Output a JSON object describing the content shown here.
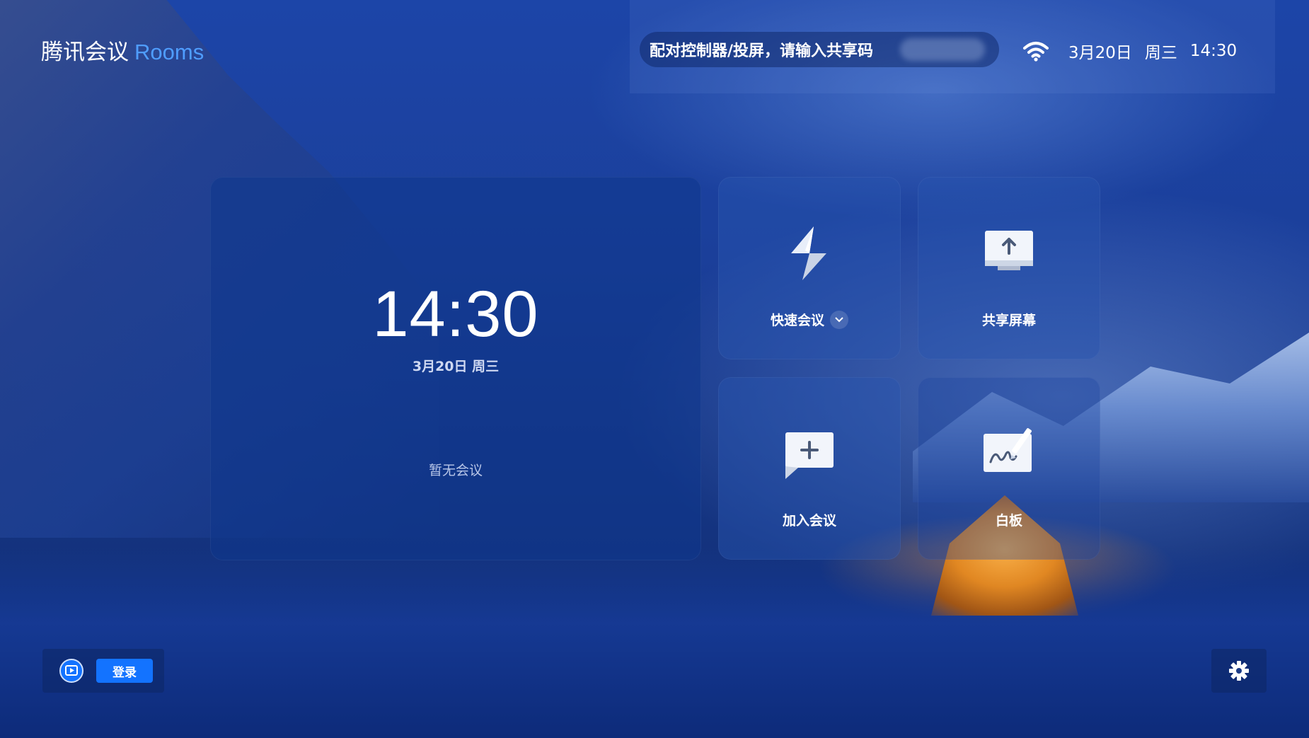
{
  "brand": {
    "name_cn": "腾讯会议",
    "name_en": "Rooms"
  },
  "header": {
    "pair_prompt": "配对控制器/投屏，请输入共享码",
    "date": "3月20日",
    "weekday": "周三",
    "time": "14:30",
    "wifi_icon": "wifi-icon"
  },
  "clock": {
    "time": "14:30",
    "date": "3月20日  周三",
    "empty_message": "暂无会议"
  },
  "tiles": [
    {
      "label": "快速会议",
      "icon": "lightning-icon",
      "has_dropdown": true
    },
    {
      "label": "共享屏幕",
      "icon": "share-screen-icon"
    },
    {
      "label": "加入会议",
      "icon": "join-meeting-icon"
    },
    {
      "label": "白板",
      "icon": "whiteboard-icon"
    }
  ],
  "footer": {
    "login_label": "登录",
    "screen_icon": "screen-cast-icon",
    "settings_icon": "gear-icon"
  },
  "colors": {
    "accent_blue": "#1373ff",
    "brand_blue": "#4f9dff"
  }
}
